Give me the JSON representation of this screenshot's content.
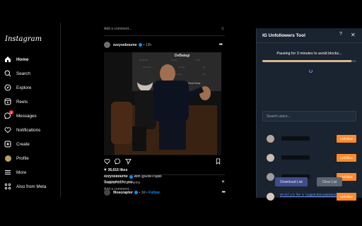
{
  "app": {
    "logo": "Instagram"
  },
  "nav": {
    "items": [
      {
        "label": "Home",
        "icon": "home-icon",
        "active": true
      },
      {
        "label": "Search",
        "icon": "search-icon"
      },
      {
        "label": "Explore",
        "icon": "compass-icon"
      },
      {
        "label": "Reels",
        "icon": "reels-icon"
      },
      {
        "label": "Messages",
        "icon": "messenger-icon",
        "badge": "1"
      },
      {
        "label": "Notifications",
        "icon": "heart-icon"
      },
      {
        "label": "Create",
        "icon": "plus-square-icon"
      },
      {
        "label": "Profile",
        "icon": "profile-avatar-icon"
      },
      {
        "label": "More",
        "icon": "hamburger-icon"
      },
      {
        "label": "Also from Meta",
        "icon": "meta-grid-icon"
      }
    ]
  },
  "feed": {
    "top_comment_placeholder": "Add a comment...",
    "post": {
      "username": "ozzyosbourne",
      "time": "13h",
      "sign_text_1": "DeBalagi",
      "sign_text_2": "The Final Show",
      "likes": "36,616 likes",
      "caption_user": "ozzyosbourne",
      "caption_with": "with",
      "caption_mention": "@RobTrujillo",
      "view_comments": "View all 100 comments",
      "comment_placeholder": "Add a comment..."
    },
    "suggested": {
      "heading": "Suggested for you",
      "username": "filosoraptor",
      "time": "3d",
      "follow": "Follow"
    }
  },
  "extension": {
    "title": "IG Unfollowers Tool",
    "help": "?",
    "status": "Pausing for 3 minutes to avoid blocks...",
    "progress": 0.95,
    "search_placeholder": "Search users...",
    "users": [
      {
        "unfollow_label": "Unfollow"
      },
      {
        "unfollow_label": "Unfollow"
      },
      {
        "unfollow_label": "Unfollow"
      },
      {
        "unfollow_label": "Unfollow"
      }
    ],
    "download_label": "Download List",
    "clear_label": "Clear List",
    "support_link": "Would you like to support this extension?"
  },
  "colors": {
    "accent_blue": "#0095f6",
    "unfollow_orange": "#ff8a2a",
    "panel_bg": "#1a2330",
    "notification_red": "#ff3040"
  }
}
